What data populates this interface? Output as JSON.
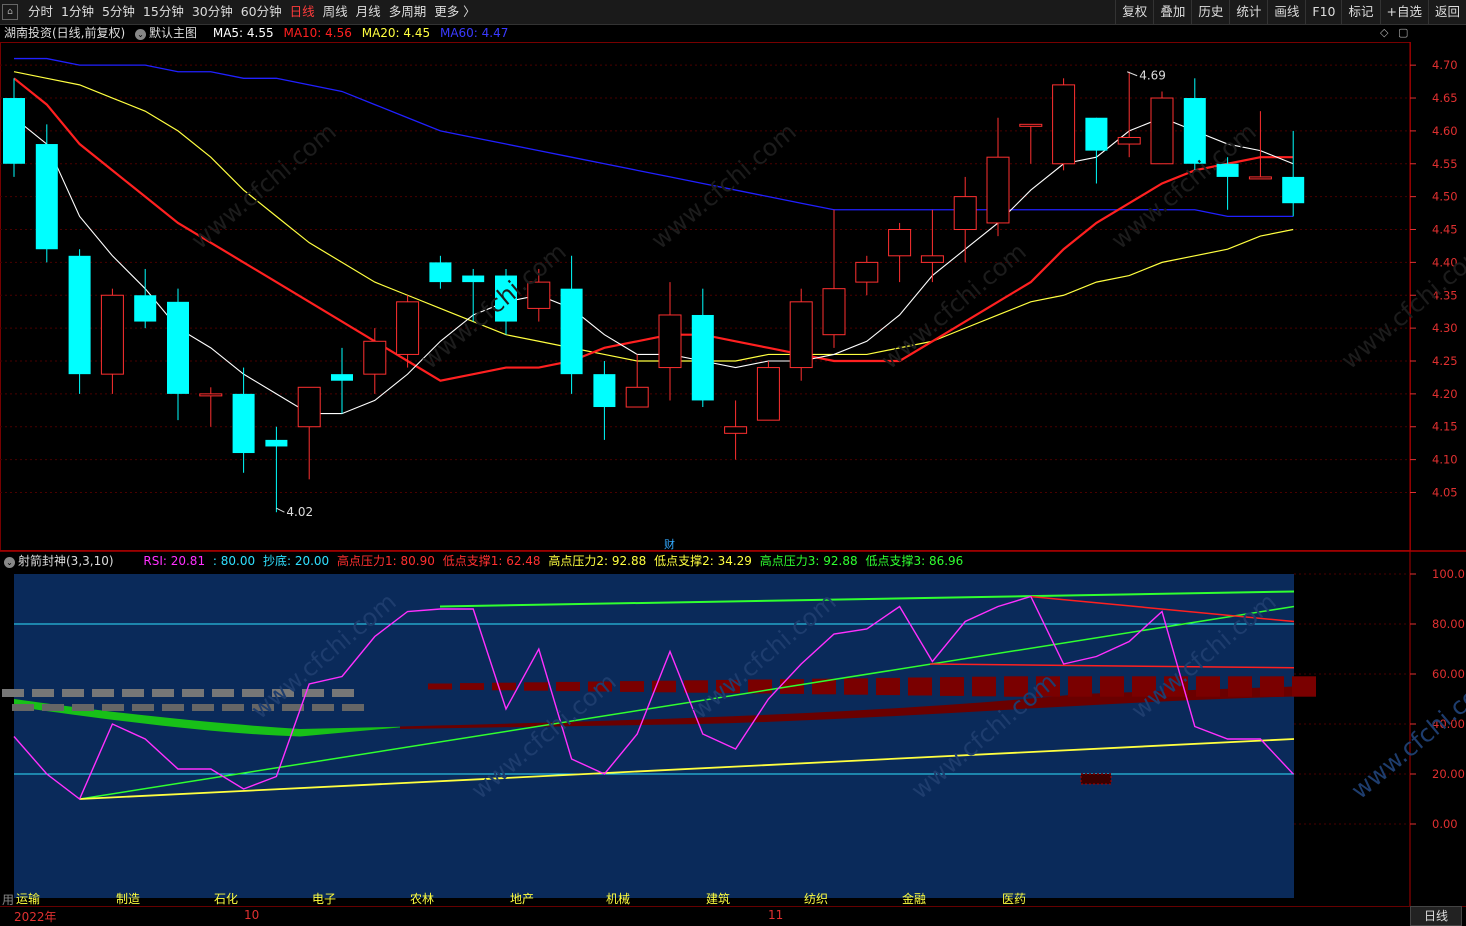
{
  "toolbar": {
    "periods": [
      "分时",
      "1分钟",
      "5分钟",
      "15分钟",
      "30分钟",
      "60分钟",
      "日线",
      "周线",
      "月线",
      "多周期",
      "更多 〉"
    ],
    "active_period": "日线",
    "tools": [
      "复权",
      "叠加",
      "历史",
      "统计",
      "画线",
      "F10",
      "标记",
      "+自选",
      "返回"
    ]
  },
  "main_info": {
    "stock": "湖南投资(日线,前复权)",
    "template": "默认主图",
    "ma5_label": "MA5: 4.55",
    "ma10_label": "MA10: 4.56",
    "ma20_label": "MA20: 4.45",
    "ma60_label": "MA60: 4.47"
  },
  "colors": {
    "ma5": "#ffffff",
    "ma10": "#ff2020",
    "ma20": "#ffff40",
    "ma60": "#2020ff",
    "up": "#ff3030",
    "down": "#00ffff",
    "axis": "#e03030",
    "rsi": "#ff30ff",
    "sub_bg": "#0a2a5a"
  },
  "price_axis": {
    "labels": [
      "4.70",
      "4.65",
      "4.60",
      "4.55",
      "4.50",
      "4.45",
      "4.40",
      "4.35",
      "4.30",
      "4.25",
      "4.20",
      "4.15",
      "4.10",
      "4.05"
    ]
  },
  "annotations": {
    "high": "4.69",
    "low": "4.02",
    "fin_marker": "财"
  },
  "sub_info": {
    "name": "射箭封神(3,3,10)",
    "rsi": "RSI: 20.81",
    "rsi2": ": 80.00",
    "chaodi": "抄底: 20.00",
    "hp1": "高点压力1: 80.90",
    "ls1": "低点支撑1: 62.48",
    "hp2": "高点压力2: 92.88",
    "ls2": "低点支撑2: 34.29",
    "hp3": "高点压力3: 92.88",
    "ls3": "低点支撑3: 86.96"
  },
  "sub_axis": {
    "labels": [
      "100.0",
      "80.00",
      "60.00",
      "40.00",
      "20.00",
      "0.00"
    ]
  },
  "sectors": [
    "运输",
    "制造",
    "石化",
    "电子",
    "农林",
    "地产",
    "机械",
    "建筑",
    "纺织",
    "金融",
    "医药"
  ],
  "bottom": {
    "year": "2022年",
    "m10": "10",
    "m11": "11",
    "period_button": "日线",
    "left_tab": "用"
  },
  "chart_data": {
    "type": "candlestick",
    "candles": [
      {
        "o": 4.65,
        "h": 4.68,
        "l": 4.53,
        "c": 4.55
      },
      {
        "o": 4.58,
        "h": 4.61,
        "l": 4.4,
        "c": 4.42
      },
      {
        "o": 4.41,
        "h": 4.42,
        "l": 4.2,
        "c": 4.23
      },
      {
        "o": 4.23,
        "h": 4.36,
        "l": 4.2,
        "c": 4.35
      },
      {
        "o": 4.35,
        "h": 4.39,
        "l": 4.3,
        "c": 4.31
      },
      {
        "o": 4.34,
        "h": 4.36,
        "l": 4.16,
        "c": 4.2
      },
      {
        "o": 4.2,
        "h": 4.21,
        "l": 4.15,
        "c": 4.2
      },
      {
        "o": 4.2,
        "h": 4.24,
        "l": 4.08,
        "c": 4.11
      },
      {
        "o": 4.13,
        "h": 4.15,
        "l": 4.02,
        "c": 4.12
      },
      {
        "o": 4.15,
        "h": 4.2,
        "l": 4.07,
        "c": 4.21
      },
      {
        "o": 4.23,
        "h": 4.27,
        "l": 4.17,
        "c": 4.22
      },
      {
        "o": 4.23,
        "h": 4.3,
        "l": 4.2,
        "c": 4.28
      },
      {
        "o": 4.26,
        "h": 4.35,
        "l": 4.24,
        "c": 4.34
      },
      {
        "o": 4.4,
        "h": 4.41,
        "l": 4.36,
        "c": 4.37
      },
      {
        "o": 4.38,
        "h": 4.39,
        "l": 4.31,
        "c": 4.37
      },
      {
        "o": 4.38,
        "h": 4.39,
        "l": 4.29,
        "c": 4.31
      },
      {
        "o": 4.33,
        "h": 4.39,
        "l": 4.31,
        "c": 4.37
      },
      {
        "o": 4.36,
        "h": 4.41,
        "l": 4.2,
        "c": 4.23
      },
      {
        "o": 4.23,
        "h": 4.25,
        "l": 4.13,
        "c": 4.18
      },
      {
        "o": 4.18,
        "h": 4.26,
        "l": 4.18,
        "c": 4.21
      },
      {
        "o": 4.24,
        "h": 4.37,
        "l": 4.19,
        "c": 4.32
      },
      {
        "o": 4.32,
        "h": 4.36,
        "l": 4.18,
        "c": 4.19
      },
      {
        "o": 4.14,
        "h": 4.19,
        "l": 4.1,
        "c": 4.15
      },
      {
        "o": 4.16,
        "h": 4.25,
        "l": 4.16,
        "c": 4.24
      },
      {
        "o": 4.24,
        "h": 4.36,
        "l": 4.22,
        "c": 4.34
      },
      {
        "o": 4.29,
        "h": 4.48,
        "l": 4.27,
        "c": 4.36
      },
      {
        "o": 4.37,
        "h": 4.41,
        "l": 4.35,
        "c": 4.4
      },
      {
        "o": 4.41,
        "h": 4.46,
        "l": 4.37,
        "c": 4.45
      },
      {
        "o": 4.4,
        "h": 4.48,
        "l": 4.37,
        "c": 4.41
      },
      {
        "o": 4.45,
        "h": 4.53,
        "l": 4.4,
        "c": 4.5
      },
      {
        "o": 4.46,
        "h": 4.62,
        "l": 4.44,
        "c": 4.56
      },
      {
        "o": 4.61,
        "h": 4.61,
        "l": 4.55,
        "c": 4.61
      },
      {
        "o": 4.55,
        "h": 4.68,
        "l": 4.54,
        "c": 4.67
      },
      {
        "o": 4.62,
        "h": 4.62,
        "l": 4.52,
        "c": 4.57
      },
      {
        "o": 4.58,
        "h": 4.69,
        "l": 4.56,
        "c": 4.59
      },
      {
        "o": 4.55,
        "h": 4.66,
        "l": 4.55,
        "c": 4.65
      },
      {
        "o": 4.65,
        "h": 4.68,
        "l": 4.54,
        "c": 4.55
      },
      {
        "o": 4.55,
        "h": 4.56,
        "l": 4.48,
        "c": 4.53
      },
      {
        "o": 4.53,
        "h": 4.63,
        "l": 4.53,
        "c": 4.53
      },
      {
        "o": 4.53,
        "h": 4.6,
        "l": 4.47,
        "c": 4.49
      }
    ],
    "ma5": [
      4.62,
      4.58,
      4.47,
      4.41,
      4.36,
      4.3,
      4.27,
      4.23,
      4.2,
      4.17,
      4.17,
      4.19,
      4.23,
      4.28,
      4.32,
      4.34,
      4.35,
      4.33,
      4.29,
      4.26,
      4.26,
      4.25,
      4.24,
      4.25,
      4.25,
      4.26,
      4.28,
      4.32,
      4.38,
      4.42,
      4.46,
      4.51,
      4.55,
      4.56,
      4.6,
      4.62,
      4.6,
      4.58,
      4.57,
      4.55
    ],
    "ma10": [
      4.68,
      4.64,
      4.58,
      4.54,
      4.5,
      4.46,
      4.43,
      4.4,
      4.37,
      4.34,
      4.31,
      4.28,
      4.25,
      4.22,
      4.23,
      4.24,
      4.24,
      4.25,
      4.27,
      4.28,
      4.29,
      4.29,
      4.28,
      4.27,
      4.26,
      4.25,
      4.25,
      4.25,
      4.28,
      4.31,
      4.34,
      4.37,
      4.42,
      4.46,
      4.49,
      4.52,
      4.54,
      4.55,
      4.56,
      4.56
    ],
    "ma20": [
      4.69,
      4.68,
      4.67,
      4.65,
      4.63,
      4.6,
      4.56,
      4.51,
      4.47,
      4.43,
      4.4,
      4.37,
      4.35,
      4.33,
      4.31,
      4.29,
      4.28,
      4.27,
      4.26,
      4.25,
      4.25,
      4.25,
      4.25,
      4.26,
      4.26,
      4.26,
      4.26,
      4.27,
      4.28,
      4.3,
      4.32,
      4.34,
      4.35,
      4.37,
      4.38,
      4.4,
      4.41,
      4.42,
      4.44,
      4.45
    ],
    "ma60": [
      4.71,
      4.71,
      4.7,
      4.7,
      4.7,
      4.69,
      4.69,
      4.68,
      4.68,
      4.67,
      4.66,
      4.64,
      4.62,
      4.6,
      4.59,
      4.58,
      4.57,
      4.56,
      4.55,
      4.54,
      4.53,
      4.52,
      4.51,
      4.5,
      4.49,
      4.48,
      4.48,
      4.48,
      4.48,
      4.48,
      4.48,
      4.48,
      4.48,
      4.48,
      4.48,
      4.48,
      4.48,
      4.47,
      4.47,
      4.47
    ],
    "rsi": [
      35,
      20,
      10,
      40,
      34,
      22,
      22,
      14,
      19,
      56,
      59,
      75,
      85,
      86,
      86,
      46,
      70,
      26,
      20,
      36,
      69,
      36,
      30,
      50,
      64,
      76,
      78,
      87,
      65,
      81,
      87,
      91,
      64,
      67,
      73,
      85,
      39,
      34,
      34,
      20
    ],
    "sub_ylim": [
      0,
      100
    ]
  }
}
